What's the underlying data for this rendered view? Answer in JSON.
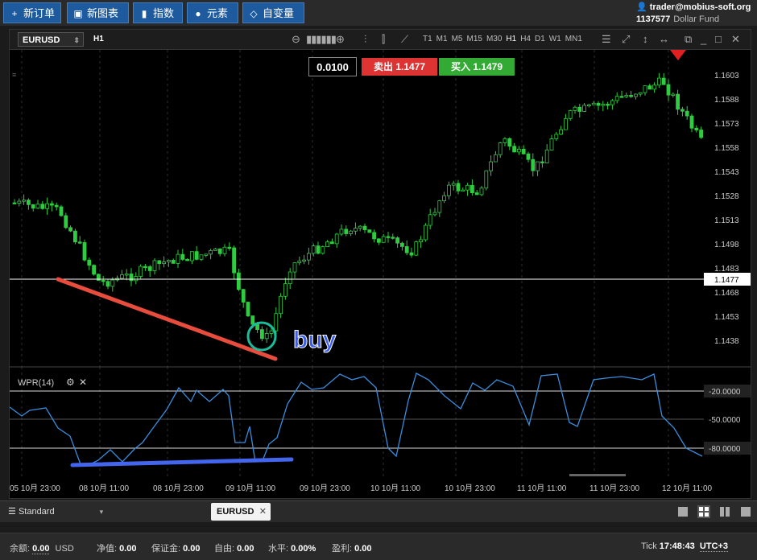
{
  "toolbar": {
    "buttons": [
      {
        "label": "新订单",
        "icon": "plus-icon"
      },
      {
        "label": "新图表",
        "icon": "chart-icon"
      },
      {
        "label": "指数",
        "icon": "bars-icon"
      },
      {
        "label": "元素",
        "icon": "shapes-icon"
      },
      {
        "label": "自变量",
        "icon": "diamond-icon"
      }
    ]
  },
  "account": {
    "user": "trader@mobius-soft.org",
    "id": "1137577",
    "fund": "Dollar Fund"
  },
  "chart": {
    "symbol": "EURUSD",
    "timeframe": "H1",
    "timeframes": [
      "T1",
      "M1",
      "M5",
      "M15",
      "M30",
      "H1",
      "H4",
      "D1",
      "W1",
      "MN1"
    ],
    "lot": "0.0100",
    "sell_label": "卖出",
    "sell_price": "1.1477",
    "buy_label": "买入",
    "buy_price": "1.1479",
    "current_price": "1.1477",
    "annotation": "buy",
    "indicator": "WPR(14)",
    "price_ticks": [
      "1.1603",
      "1.1588",
      "1.1573",
      "1.1558",
      "1.1543",
      "1.1528",
      "1.1513",
      "1.1498",
      "1.1483",
      "1.1468",
      "1.1453",
      "1.1438"
    ],
    "wpr_ticks": [
      "-20.0000",
      "-50.0000",
      "-80.0000"
    ],
    "time_ticks": [
      "05 10月 23:00",
      "08 10月 11:00",
      "08 10月 23:00",
      "09 10月 11:00",
      "09 10月 23:00",
      "10 10月 11:00",
      "10 10月 23:00",
      "11 10月 11:00",
      "11 10月 23:00",
      "12 10月 11:00"
    ]
  },
  "bottom": {
    "template": "Standard",
    "tab": "EURUSD"
  },
  "status": {
    "balance_label": "余额:",
    "balance": "0.00",
    "currency": "USD",
    "equity_label": "净值:",
    "equity": "0.00",
    "margin_label": "保证金:",
    "margin": "0.00",
    "free_label": "自由:",
    "free": "0.00",
    "level_label": "水平:",
    "level": "0.00%",
    "profit_label": "盈利:",
    "profit": "0.00",
    "tick_label": "Tick",
    "time": "17:48:43",
    "tz": "UTC+3"
  },
  "colors": {
    "up": "#2ecc40",
    "line": "#3a8dde",
    "trend": "#e74c3c",
    "wpr_trend": "#4466ee",
    "circle": "#1abc9c"
  }
}
